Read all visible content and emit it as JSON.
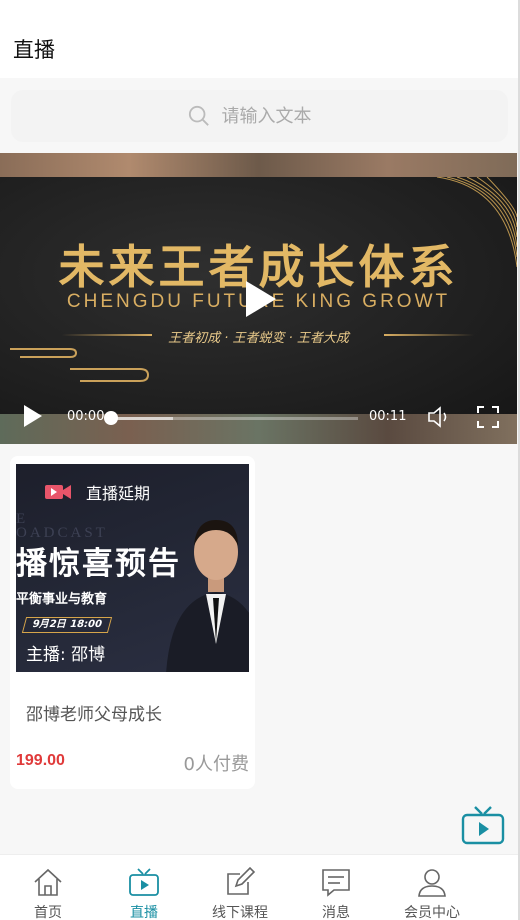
{
  "header": {
    "title": "直播"
  },
  "search": {
    "placeholder": "请输入文本"
  },
  "video": {
    "banner_title": "未来王者成长体系",
    "banner_subtitle": "CHENGDU  FUTURE  KING  GROWT",
    "banner_tagline": "王者初成 · 王者蜕变  · 王者大成",
    "current_time": "00:00",
    "duration": "00:11",
    "progress": 0.0
  },
  "live_card": {
    "status": "直播延期",
    "thumb_broadcast": "E\nOADCAST",
    "thumb_promo": "播惊喜预告",
    "thumb_sub": "平衡事业与教育",
    "thumb_date": "9月2日 18:00",
    "host": "主播: 邵博",
    "title": "邵博老师父母成长",
    "price": "199.00",
    "paid_count": "0人付费"
  },
  "tabs": [
    {
      "label": "首页",
      "icon": "home-icon"
    },
    {
      "label": "直播",
      "icon": "tv-icon",
      "active": true
    },
    {
      "label": "线下课程",
      "icon": "edit-icon"
    },
    {
      "label": "消息",
      "icon": "message-icon"
    },
    {
      "label": "会员中心",
      "icon": "user-icon"
    }
  ],
  "colors": {
    "accent": "#1a8fa3",
    "price": "#e03a3a",
    "banner_gold": "#e2b865"
  }
}
